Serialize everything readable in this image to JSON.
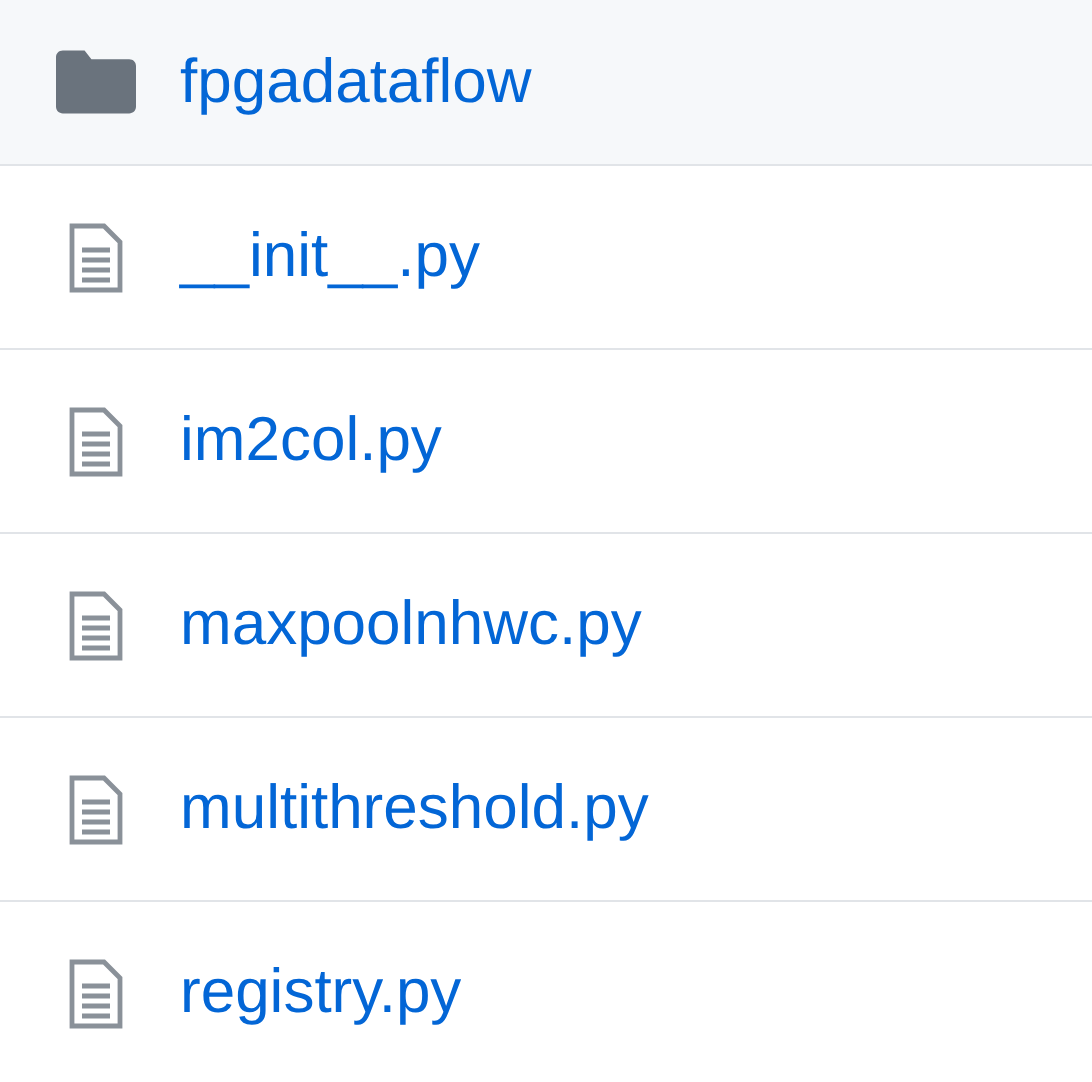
{
  "items": [
    {
      "kind": "folder",
      "name": "fpgadataflow"
    },
    {
      "kind": "file",
      "name": "__init__.py"
    },
    {
      "kind": "file",
      "name": "im2col.py"
    },
    {
      "kind": "file",
      "name": "maxpoolnhwc.py"
    },
    {
      "kind": "file",
      "name": "multithreshold.py"
    },
    {
      "kind": "file",
      "name": "registry.py"
    }
  ]
}
